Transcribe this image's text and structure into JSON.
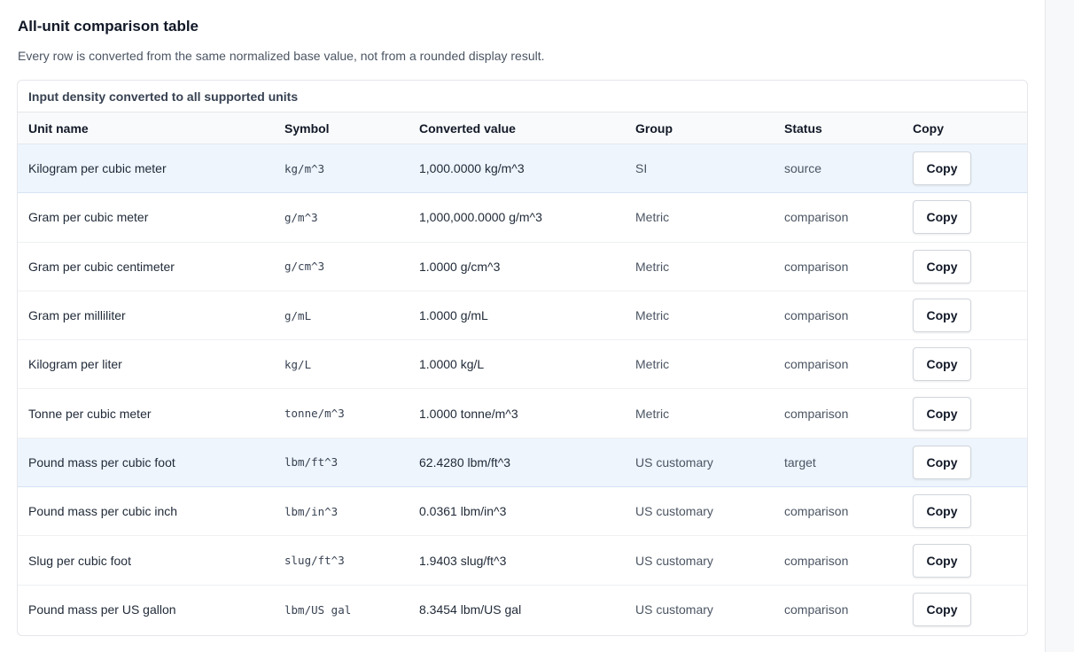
{
  "section": {
    "title": "All-unit comparison table",
    "description": "Every row is converted from the same normalized base value, not from a rounded display result."
  },
  "table": {
    "caption": "Input density converted to all supported units",
    "headers": {
      "unit_name": "Unit name",
      "symbol": "Symbol",
      "converted_value": "Converted value",
      "group": "Group",
      "status": "Status",
      "copy": "Copy"
    },
    "rows": [
      {
        "name": "Kilogram per cubic meter",
        "symbol": "kg/m^3",
        "value": "1,000.0000 kg/m^3",
        "group": "SI",
        "status": "source",
        "copy": "Copy",
        "highlight": true
      },
      {
        "name": "Gram per cubic meter",
        "symbol": "g/m^3",
        "value": "1,000,000.0000 g/m^3",
        "group": "Metric",
        "status": "comparison",
        "copy": "Copy",
        "highlight": false
      },
      {
        "name": "Gram per cubic centimeter",
        "symbol": "g/cm^3",
        "value": "1.0000 g/cm^3",
        "group": "Metric",
        "status": "comparison",
        "copy": "Copy",
        "highlight": false
      },
      {
        "name": "Gram per milliliter",
        "symbol": "g/mL",
        "value": "1.0000 g/mL",
        "group": "Metric",
        "status": "comparison",
        "copy": "Copy",
        "highlight": false
      },
      {
        "name": "Kilogram per liter",
        "symbol": "kg/L",
        "value": "1.0000 kg/L",
        "group": "Metric",
        "status": "comparison",
        "copy": "Copy",
        "highlight": false
      },
      {
        "name": "Tonne per cubic meter",
        "symbol": "tonne/m^3",
        "value": "1.0000 tonne/m^3",
        "group": "Metric",
        "status": "comparison",
        "copy": "Copy",
        "highlight": false
      },
      {
        "name": "Pound mass per cubic foot",
        "symbol": "lbm/ft^3",
        "value": "62.4280 lbm/ft^3",
        "group": "US customary",
        "status": "target",
        "copy": "Copy",
        "highlight": true
      },
      {
        "name": "Pound mass per cubic inch",
        "symbol": "lbm/in^3",
        "value": "0.0361 lbm/in^3",
        "group": "US customary",
        "status": "comparison",
        "copy": "Copy",
        "highlight": false
      },
      {
        "name": "Slug per cubic foot",
        "symbol": "slug/ft^3",
        "value": "1.9403 slug/ft^3",
        "group": "US customary",
        "status": "comparison",
        "copy": "Copy",
        "highlight": false
      },
      {
        "name": "Pound mass per US gallon",
        "symbol": "lbm/US gal",
        "value": "8.3454 lbm/US gal",
        "group": "US customary",
        "status": "comparison",
        "copy": "Copy",
        "highlight": false
      }
    ]
  }
}
